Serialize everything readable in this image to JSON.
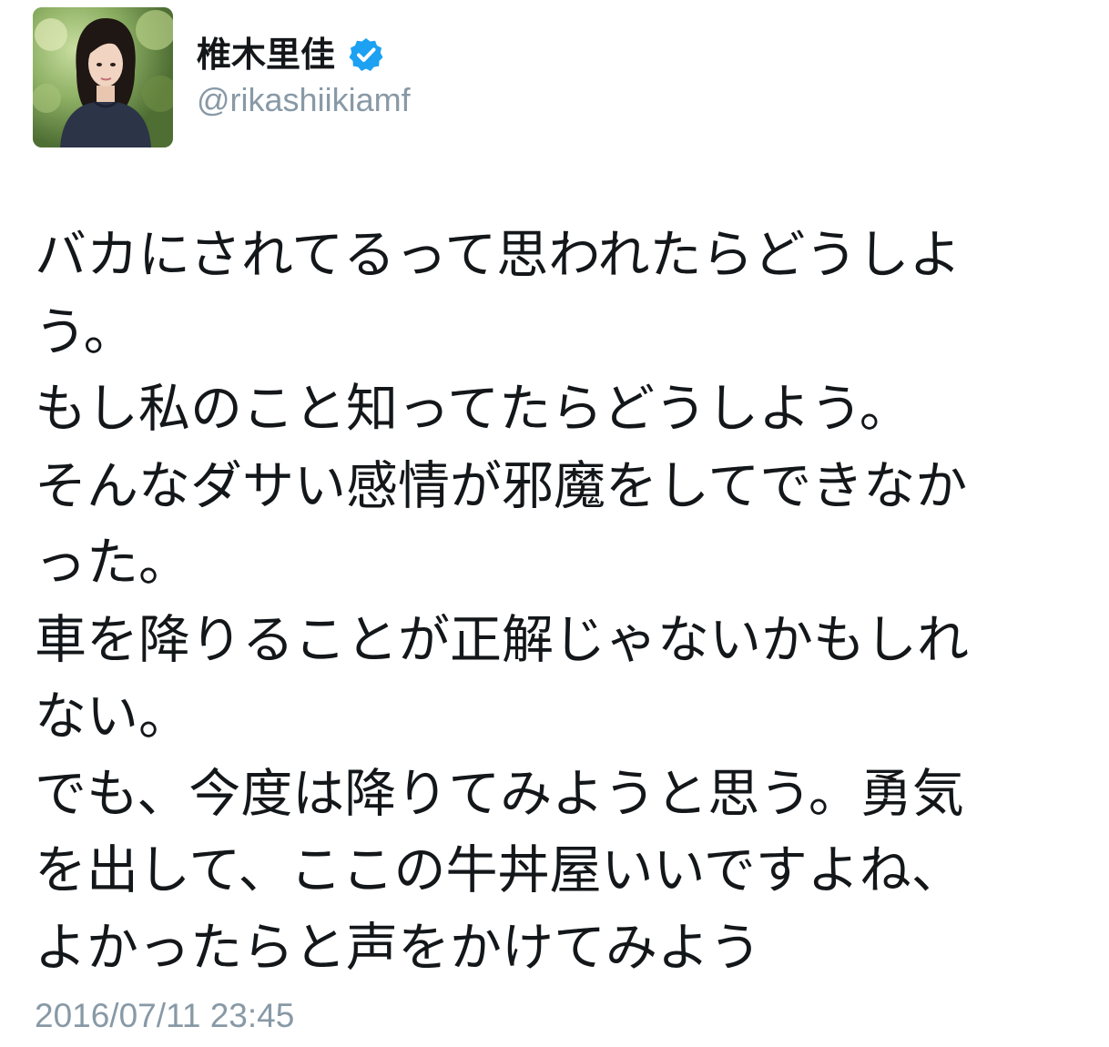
{
  "author": {
    "display_name": "椎木里佳",
    "handle": "@rikashiikiamf",
    "verified_icon": "verified-badge-icon",
    "verified_color": "#1da1f2"
  },
  "tweet": {
    "lines": [
      "バカにされてるって思われたらどうしよ",
      "う。",
      "もし私のこと知ってたらどうしよう。",
      "そんなダサい感情が邪魔をしてできなか",
      "った。",
      "車を降りることが正解じゃないかもしれ",
      "ない。",
      "でも、今度は降りてみようと思う。勇気",
      "を出して、ここの牛丼屋いいですよね、",
      "よかったらと声をかけてみよう"
    ],
    "timestamp": "2016/07/11 23:45"
  },
  "colors": {
    "text": "#14171a",
    "secondary_text": "#8899a6",
    "background": "#ffffff"
  }
}
